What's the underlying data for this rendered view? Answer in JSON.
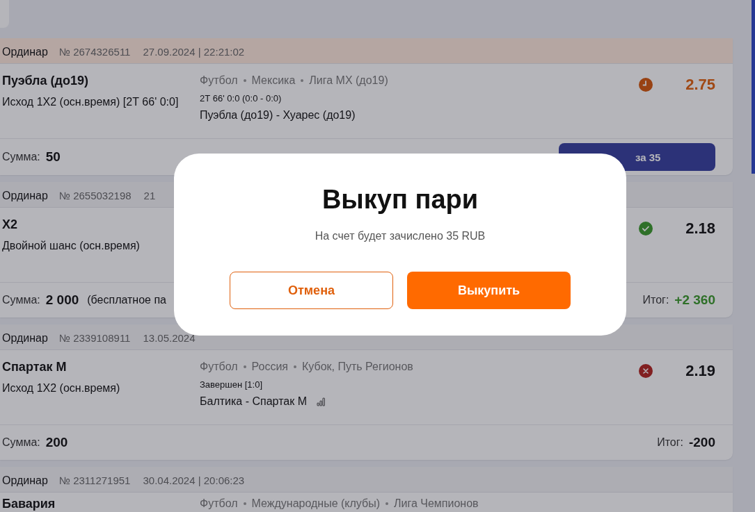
{
  "bets": [
    {
      "type": "Ординар",
      "number": "№ 2674326511",
      "date": "27.09.2024 | 22:21:02",
      "highlighted": true,
      "selection": "Пуэбла (до19)",
      "market": "Исход 1X2 (осн.время) [2Т 66' 0:0]",
      "path": [
        "Футбол",
        "Мексика",
        "Лига МХ (до19)"
      ],
      "score": "2Т 66' 0:0 (0:0 - 0:0)",
      "match": "Пуэбла (до19) - Хуарес (до19)",
      "stats": false,
      "settled": false,
      "odds": "2.75",
      "stake_label": "Сумма:",
      "stake": "50",
      "cashout": "за 35"
    },
    {
      "type": "Ординар",
      "number": "№ 2655032198",
      "date": "21",
      "highlighted": false,
      "selection": "X2",
      "market": "Двойной шанс (осн.время)",
      "settled": true,
      "won": true,
      "odds": "2.18",
      "stake_label": "Сумма:",
      "stake": "2 000",
      "note": "(бесплатное па",
      "result_label": "Итог:",
      "result": "+2 360"
    },
    {
      "type": "Ординар",
      "number": "№ 2339108911",
      "date": "13.05.2024",
      "highlighted": false,
      "selection": "Спартак М",
      "market": "Исход 1X2 (осн.время)",
      "path": [
        "Футбол",
        "Россия",
        "Кубок, Путь Регионов"
      ],
      "score": "Завершен [1:0]",
      "match": "Балтика - Спартак М",
      "stats": true,
      "settled": true,
      "won": false,
      "odds": "2.19",
      "stake_label": "Сумма:",
      "stake": "200",
      "result_label": "Итог:",
      "result": "-200"
    },
    {
      "type": "Ординар",
      "number": "№ 2311271951",
      "date": "30.04.2024 | 20:06:23",
      "highlighted": false,
      "selection": "Бавария",
      "path": [
        "Футбол",
        "Международные (клубы)",
        "Лига Чемпионов"
      ]
    }
  ],
  "dialog": {
    "title": "Выкуп пари",
    "message": "На счет будет зачислено 35 RUB",
    "buttons": [
      {
        "label": "Отмена",
        "kind": "secondary"
      },
      {
        "label": "Выкупить",
        "kind": "primary"
      }
    ]
  }
}
